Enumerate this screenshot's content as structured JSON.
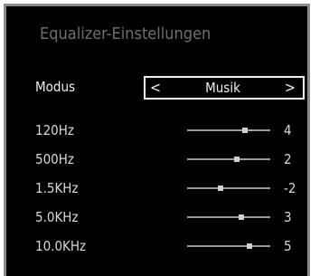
{
  "title": "Equalizer-Einstellungen",
  "mode": {
    "label": "Modus",
    "value": "Musik",
    "prev_icon": "<",
    "next_icon": ">"
  },
  "bands": [
    {
      "label": "120Hz",
      "value": "4",
      "level": 4
    },
    {
      "label": "500Hz",
      "value": "2",
      "level": 2
    },
    {
      "label": "1.5KHz",
      "value": "-2",
      "level": -2
    },
    {
      "label": "5.0KHz",
      "value": "3",
      "level": 3
    },
    {
      "label": "10.0KHz",
      "value": "5",
      "level": 5
    }
  ],
  "colors": {
    "background": "#000000",
    "border": "#8a8a8a",
    "title": "#6e6e6e",
    "text": "#e6e6e6"
  }
}
